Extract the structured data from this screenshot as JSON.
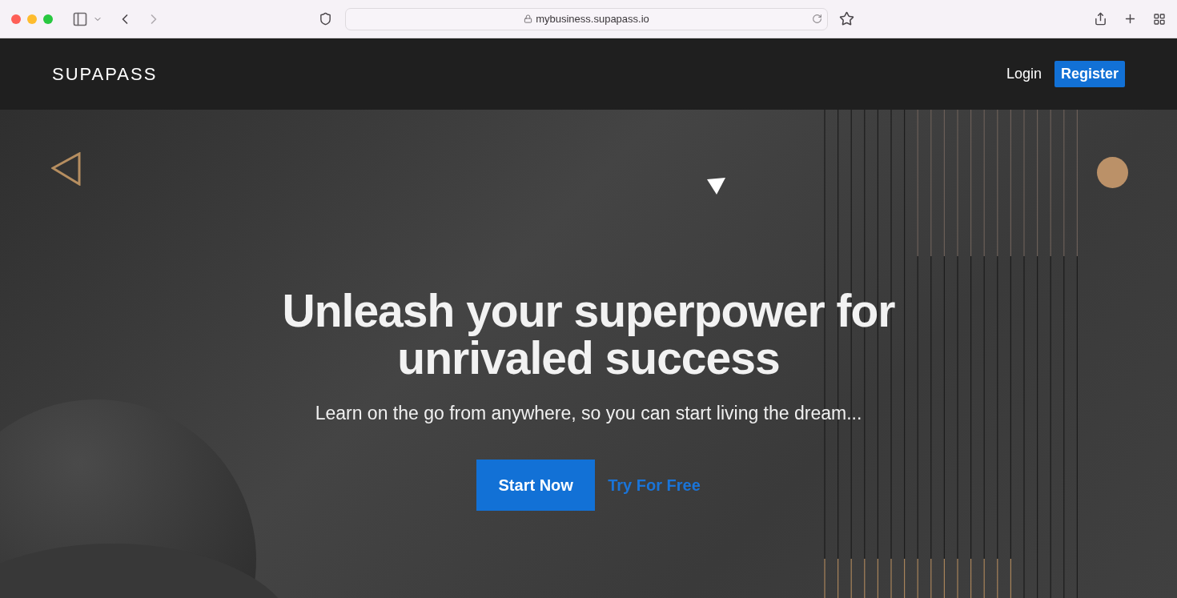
{
  "browser": {
    "url": "mybusiness.supapass.io"
  },
  "header": {
    "logo": "SUPAPASS",
    "login": "Login",
    "register": "Register"
  },
  "hero": {
    "title": "Unleash your superpower for unrivaled success",
    "subtitle": "Learn on the go from anywhere, so you can start living the dream...",
    "primary_button": "Start Now",
    "secondary_link": "Try For Free"
  }
}
